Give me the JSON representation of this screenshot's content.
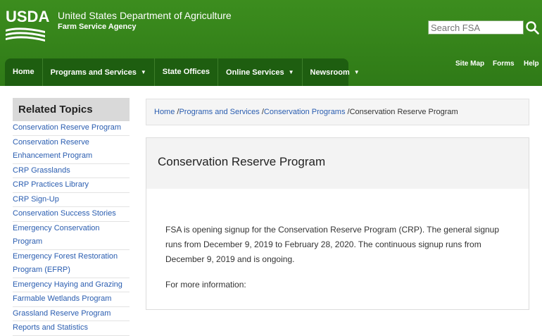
{
  "header": {
    "logo_text": "USDA",
    "agency_title": "United States Department of Agriculture",
    "agency_subtitle": "Farm Service Agency",
    "search_placeholder": "Search FSA"
  },
  "nav": {
    "items": [
      {
        "label": "Home"
      },
      {
        "label": "Programs and Services"
      },
      {
        "label": "State Offices"
      },
      {
        "label": "Online Services"
      },
      {
        "label": "Newsroom"
      }
    ],
    "utility": [
      {
        "label": "Site Map"
      },
      {
        "label": "Forms"
      },
      {
        "label": "Help"
      }
    ]
  },
  "sidebar": {
    "heading": "Related Topics",
    "items": [
      "Conservation Reserve Program",
      "Conservation Reserve",
      "Enhancement Program",
      "CRP Grasslands",
      "CRP Practices Library",
      "CRP Sign-Up",
      "Conservation Success Stories",
      "Emergency Conservation Program",
      "Emergency Forest Restoration",
      "Program (EFRP)",
      "Emergency Haying and Grazing",
      "Farmable Wetlands Program",
      "Grassland Reserve Program",
      "Reports and Statistics"
    ]
  },
  "breadcrumb": {
    "home": "Home",
    "programs": "Programs and Services",
    "conservation": "Conservation Programs",
    "current": "Conservation Reserve Program"
  },
  "main": {
    "title": "Conservation Reserve Program",
    "paragraph": "FSA is opening signup for the Conservation Reserve Program (CRP). The general signup runs from December 9, 2019 to February 28, 2020. The continuous signup runs from December 9, 2019 and is ongoing.",
    "more_info": "For more information:"
  },
  "colors": {
    "header_green": "#3c8d1e",
    "nav_green": "#1e5e10",
    "link_blue": "#2a5db0"
  },
  "icons": {
    "search": "search-icon",
    "caret": "chevron-down-icon"
  }
}
